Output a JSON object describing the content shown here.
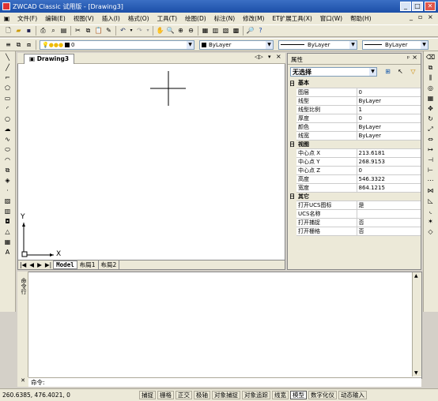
{
  "window": {
    "title": "ZWCAD Classic 试用版 - [Drawing3]"
  },
  "menu": [
    "文件(F)",
    "编辑(E)",
    "视图(V)",
    "插入(I)",
    "格式(O)",
    "工具(T)",
    "绘图(D)",
    "标注(N)",
    "修改(M)",
    "ET扩展工具(X)",
    "窗口(W)",
    "帮助(H)"
  ],
  "layer": {
    "name": "0",
    "color_label": "ByLayer",
    "linetype": "ByLayer",
    "lineweight": "ByLayer"
  },
  "drawing": {
    "tab": "Drawing3",
    "axis_x": "X",
    "axis_y": "Y"
  },
  "layouts": [
    "Model",
    "布局1",
    "布局2"
  ],
  "props": {
    "title": "属性",
    "selection": "无选择",
    "rows": [
      {
        "type": "group",
        "label": "基本",
        "sign": "日"
      },
      {
        "k": "图层",
        "v": "0"
      },
      {
        "k": "线型",
        "v": "ByLayer"
      },
      {
        "k": "线型比例",
        "v": "1"
      },
      {
        "k": "厚度",
        "v": "0"
      },
      {
        "k": "颜色",
        "v": "ByLayer"
      },
      {
        "k": "线宽",
        "v": "ByLayer"
      },
      {
        "type": "group",
        "label": "视图",
        "sign": "日"
      },
      {
        "k": "中心点 X",
        "v": "213.6181"
      },
      {
        "k": "中心点 Y",
        "v": "268.9153"
      },
      {
        "k": "中心点 Z",
        "v": "0"
      },
      {
        "k": "高度",
        "v": "546.3322"
      },
      {
        "k": "宽度",
        "v": "864.1215"
      },
      {
        "type": "group",
        "label": "其它",
        "sign": "日"
      },
      {
        "k": "打开UCS图标",
        "v": "是"
      },
      {
        "k": "UCS名称",
        "v": ""
      },
      {
        "k": "打开捕捉",
        "v": "否"
      },
      {
        "k": "打开栅格",
        "v": "否"
      }
    ]
  },
  "command": {
    "side_label": "命令行",
    "prompt": "命令:"
  },
  "status": {
    "coords": "260.6385,  476.4021,  0",
    "buttons": [
      {
        "label": "捕捉",
        "on": false
      },
      {
        "label": "栅格",
        "on": false
      },
      {
        "label": "正交",
        "on": false
      },
      {
        "label": "极轴",
        "on": false
      },
      {
        "label": "对象捕捉",
        "on": false
      },
      {
        "label": "对象追踪",
        "on": false
      },
      {
        "label": "线宽",
        "on": false
      },
      {
        "label": "模型",
        "on": true
      },
      {
        "label": "数字化仪",
        "on": false
      },
      {
        "label": "动态输入",
        "on": false
      }
    ]
  }
}
